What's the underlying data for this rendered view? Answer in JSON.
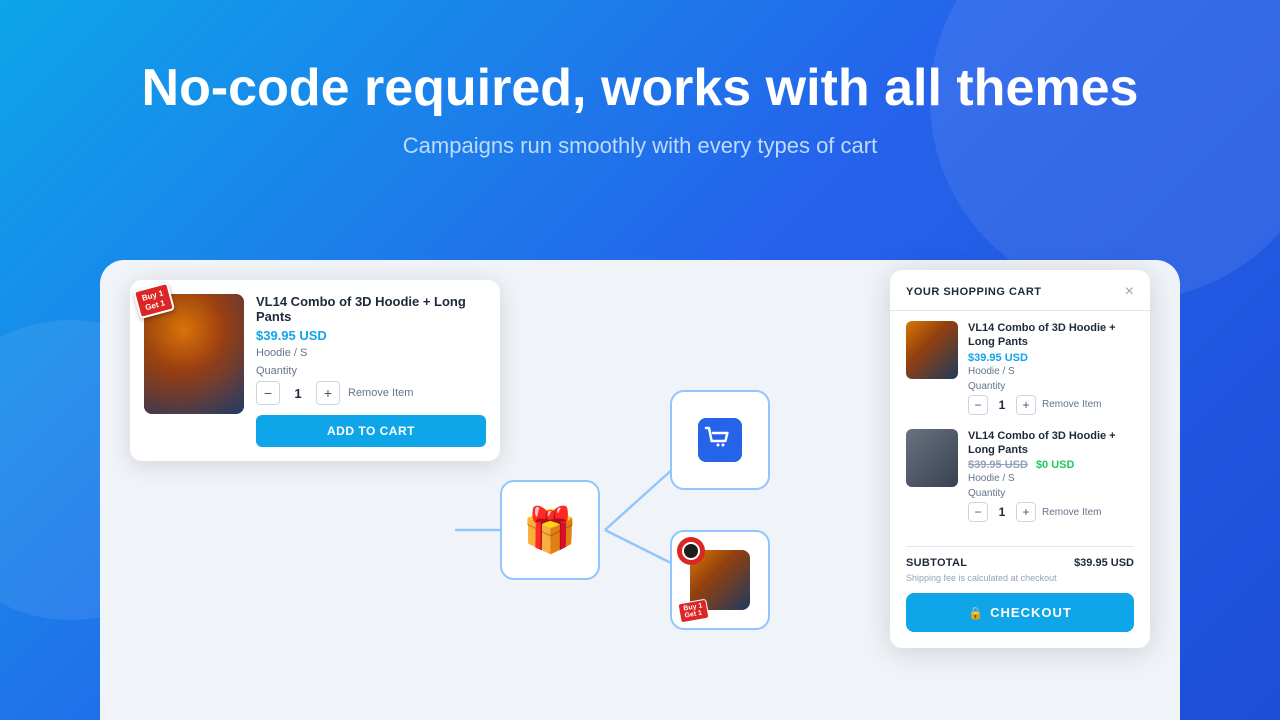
{
  "hero": {
    "title": "No-code required, works with all themes",
    "subtitle": "Campaigns run smoothly with every types of cart"
  },
  "product_popup": {
    "name": "VL14 Combo of 3D Hoodie + Long Pants",
    "price": "$39.95 USD",
    "variant": "Hoodie / S",
    "qty_label": "Quantity",
    "qty": "1",
    "remove_label": "Remove Item",
    "add_to_cart": "ADD TO CART",
    "badge": "Buy 1 Get 1"
  },
  "cart_panel": {
    "title": "YOUR SHOPPING CART",
    "close": "×",
    "items": [
      {
        "name": "VL14 Combo of 3D Hoodie + Long Pants",
        "price": "$39.95 USD",
        "variant": "Hoodie / S",
        "qty_label": "Quantity",
        "qty": "1",
        "remove_label": "Remove Item",
        "is_free": false
      },
      {
        "name": "VL14 Combo of 3D Hoodie + Long Pants",
        "price": "$39.95 USD",
        "price_free": "$0 USD",
        "variant": "Hoodie / S",
        "qty_label": "Quantity",
        "qty": "1",
        "remove_label": "Remove Item",
        "is_free": true
      }
    ],
    "subtotal_label": "SUBTOTAL",
    "subtotal_value": "$39.95 USD",
    "shipping_note": "Shipping fee is calculated at checkout",
    "checkout_label": "CHECKOUT"
  },
  "flow": {
    "gift_icon": "🎁",
    "cart_icon": "🛒",
    "badge_icon": "🏷️"
  }
}
